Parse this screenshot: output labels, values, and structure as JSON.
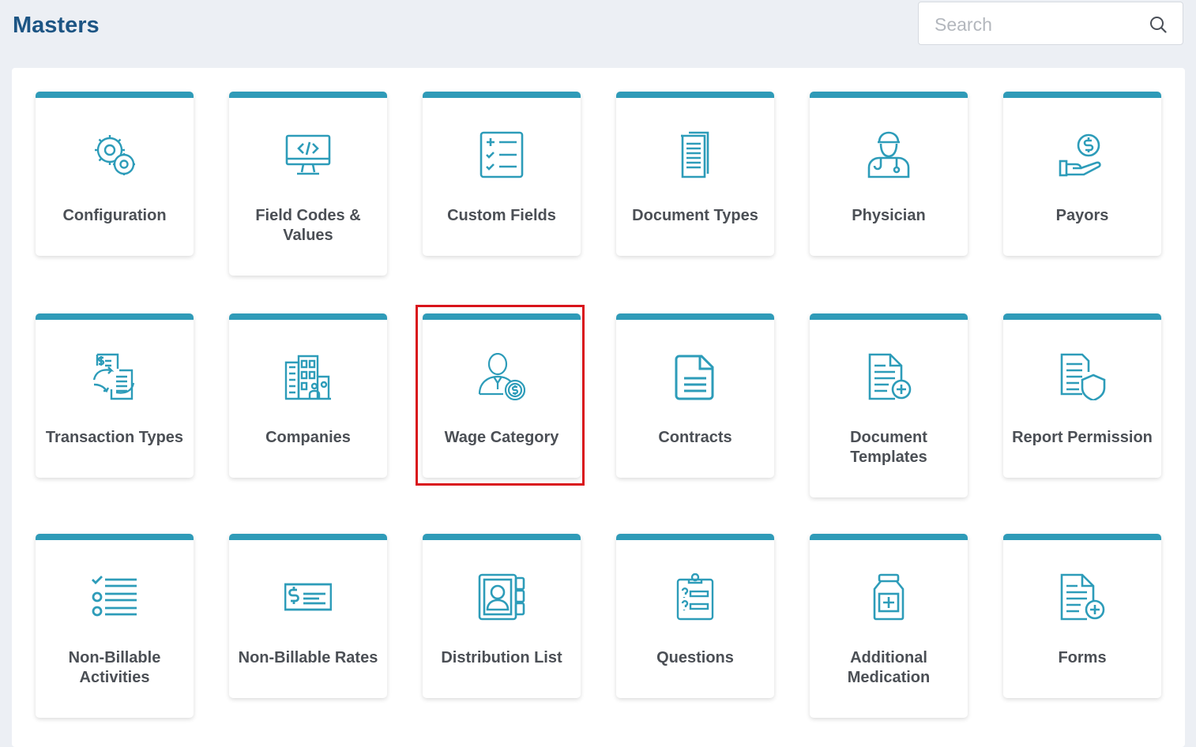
{
  "header": {
    "title": "Masters",
    "search_placeholder": "Search"
  },
  "colors": {
    "accent": "#2f9bb8",
    "icon": "#2d9cb9",
    "title": "#1d5584",
    "highlight": "#d9141b"
  },
  "tiles": [
    {
      "label": "Configuration",
      "icon": "gears-icon"
    },
    {
      "label": "Field Codes & Values",
      "icon": "monitor-code-icon"
    },
    {
      "label": "Custom Fields",
      "icon": "checklist-icon"
    },
    {
      "label": "Document Types",
      "icon": "documents-icon"
    },
    {
      "label": "Physician",
      "icon": "doctor-icon"
    },
    {
      "label": "Payors",
      "icon": "hand-dollar-icon"
    },
    {
      "label": "Transaction Types",
      "icon": "transaction-icon"
    },
    {
      "label": "Companies",
      "icon": "buildings-icon"
    },
    {
      "label": "Wage Category",
      "icon": "person-coin-icon"
    },
    {
      "label": "Contracts",
      "icon": "contract-icon"
    },
    {
      "label": "Document Templates",
      "icon": "document-plus-icon"
    },
    {
      "label": "Report Permission",
      "icon": "document-shield-icon"
    },
    {
      "label": "Non-Billable Activities",
      "icon": "list-check-icon"
    },
    {
      "label": "Non-Billable Rates",
      "icon": "money-rate-icon"
    },
    {
      "label": "Distribution List",
      "icon": "contact-book-icon"
    },
    {
      "label": "Questions",
      "icon": "clipboard-question-icon"
    },
    {
      "label": "Additional Medication",
      "icon": "medicine-bottle-icon"
    },
    {
      "label": "Forms",
      "icon": "form-plus-icon"
    }
  ],
  "selected_tile": "Wage Category"
}
